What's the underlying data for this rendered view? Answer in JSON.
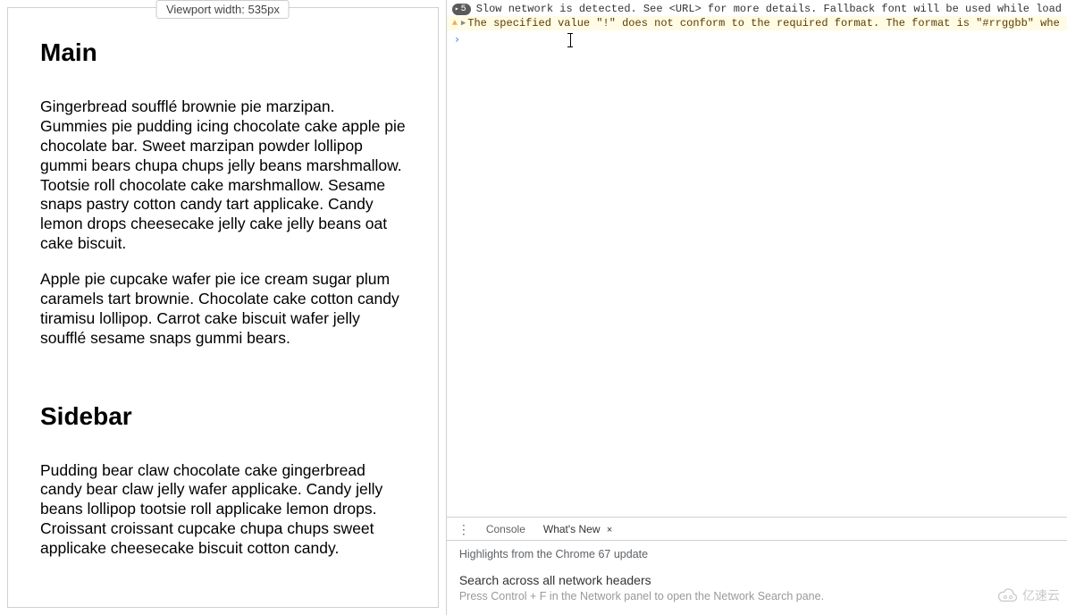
{
  "viewport_badge": "Viewport width: 535px",
  "page": {
    "main_heading": "Main",
    "main_p1": "Gingerbread soufflé brownie pie marzipan. Gummies pie pudding icing chocolate cake apple pie chocolate bar. Sweet marzipan powder lollipop gummi bears chupa chups jelly beans marshmallow. Tootsie roll chocolate cake marshmallow. Sesame snaps pastry cotton candy tart applicake. Candy lemon drops cheesecake jelly cake jelly beans oat cake biscuit.",
    "main_p2": "Apple pie cupcake wafer pie ice cream sugar plum caramels tart brownie. Chocolate cake cotton candy tiramisu lollipop. Carrot cake biscuit wafer jelly soufflé sesame snaps gummi bears.",
    "sidebar_heading": "Sidebar",
    "sidebar_p1": "Pudding bear claw chocolate cake gingerbread candy bear claw jelly wafer applicake. Candy jelly beans lollipop tootsie roll applicake lemon drops. Croissant croissant cupcake chupa chups sweet applicake cheesecake biscuit cotton candy."
  },
  "console": {
    "info_count": "5",
    "info_msg": "Slow network is detected. See <URL> for more details. Fallback font will be used while load",
    "warn_msg": "The specified value \"!\" does not conform to the required format.  The format is \"#rrggbb\" whe",
    "prompt": "›"
  },
  "drawer": {
    "tab_console": "Console",
    "tab_whatsnew": "What's New",
    "highlight": "Highlights from the Chrome 67 update",
    "section1_title": "Search across all network headers",
    "section1_sub": "Press Control + F in the Network panel to open the Network Search pane."
  },
  "watermark": "亿速云"
}
